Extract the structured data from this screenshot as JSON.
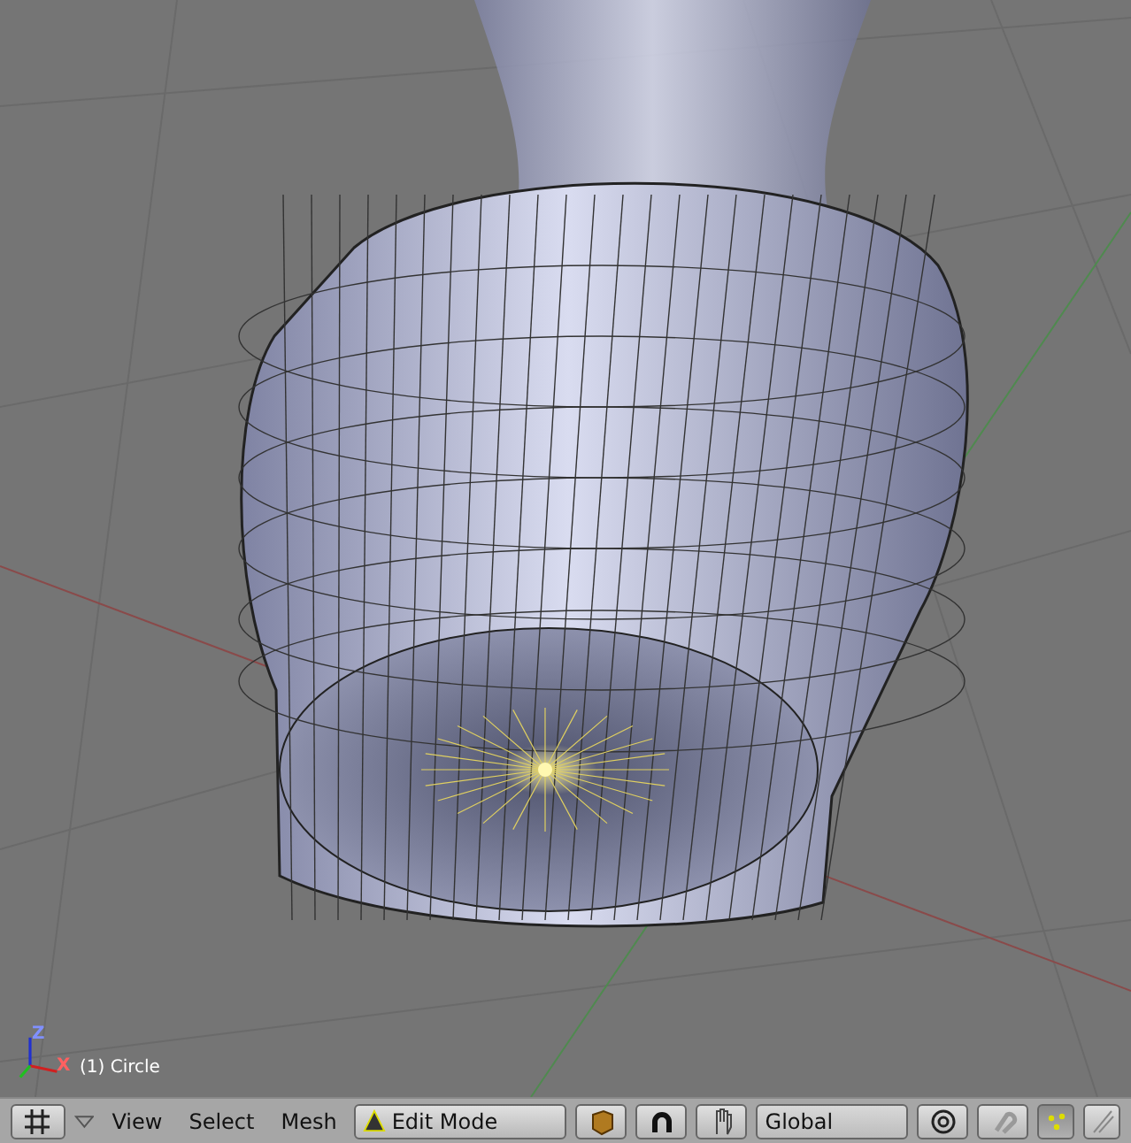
{
  "viewport": {
    "axis_labels": [
      "Z",
      "X"
    ],
    "object_label": "(1) Circle"
  },
  "toolbar": {
    "menus": [
      "View",
      "Select",
      "Mesh"
    ],
    "mode": "Edit Mode",
    "orientation": "Global",
    "select_modes": [
      {
        "kind": "vertex",
        "selected": true
      },
      {
        "kind": "edge",
        "selected": false
      }
    ]
  }
}
